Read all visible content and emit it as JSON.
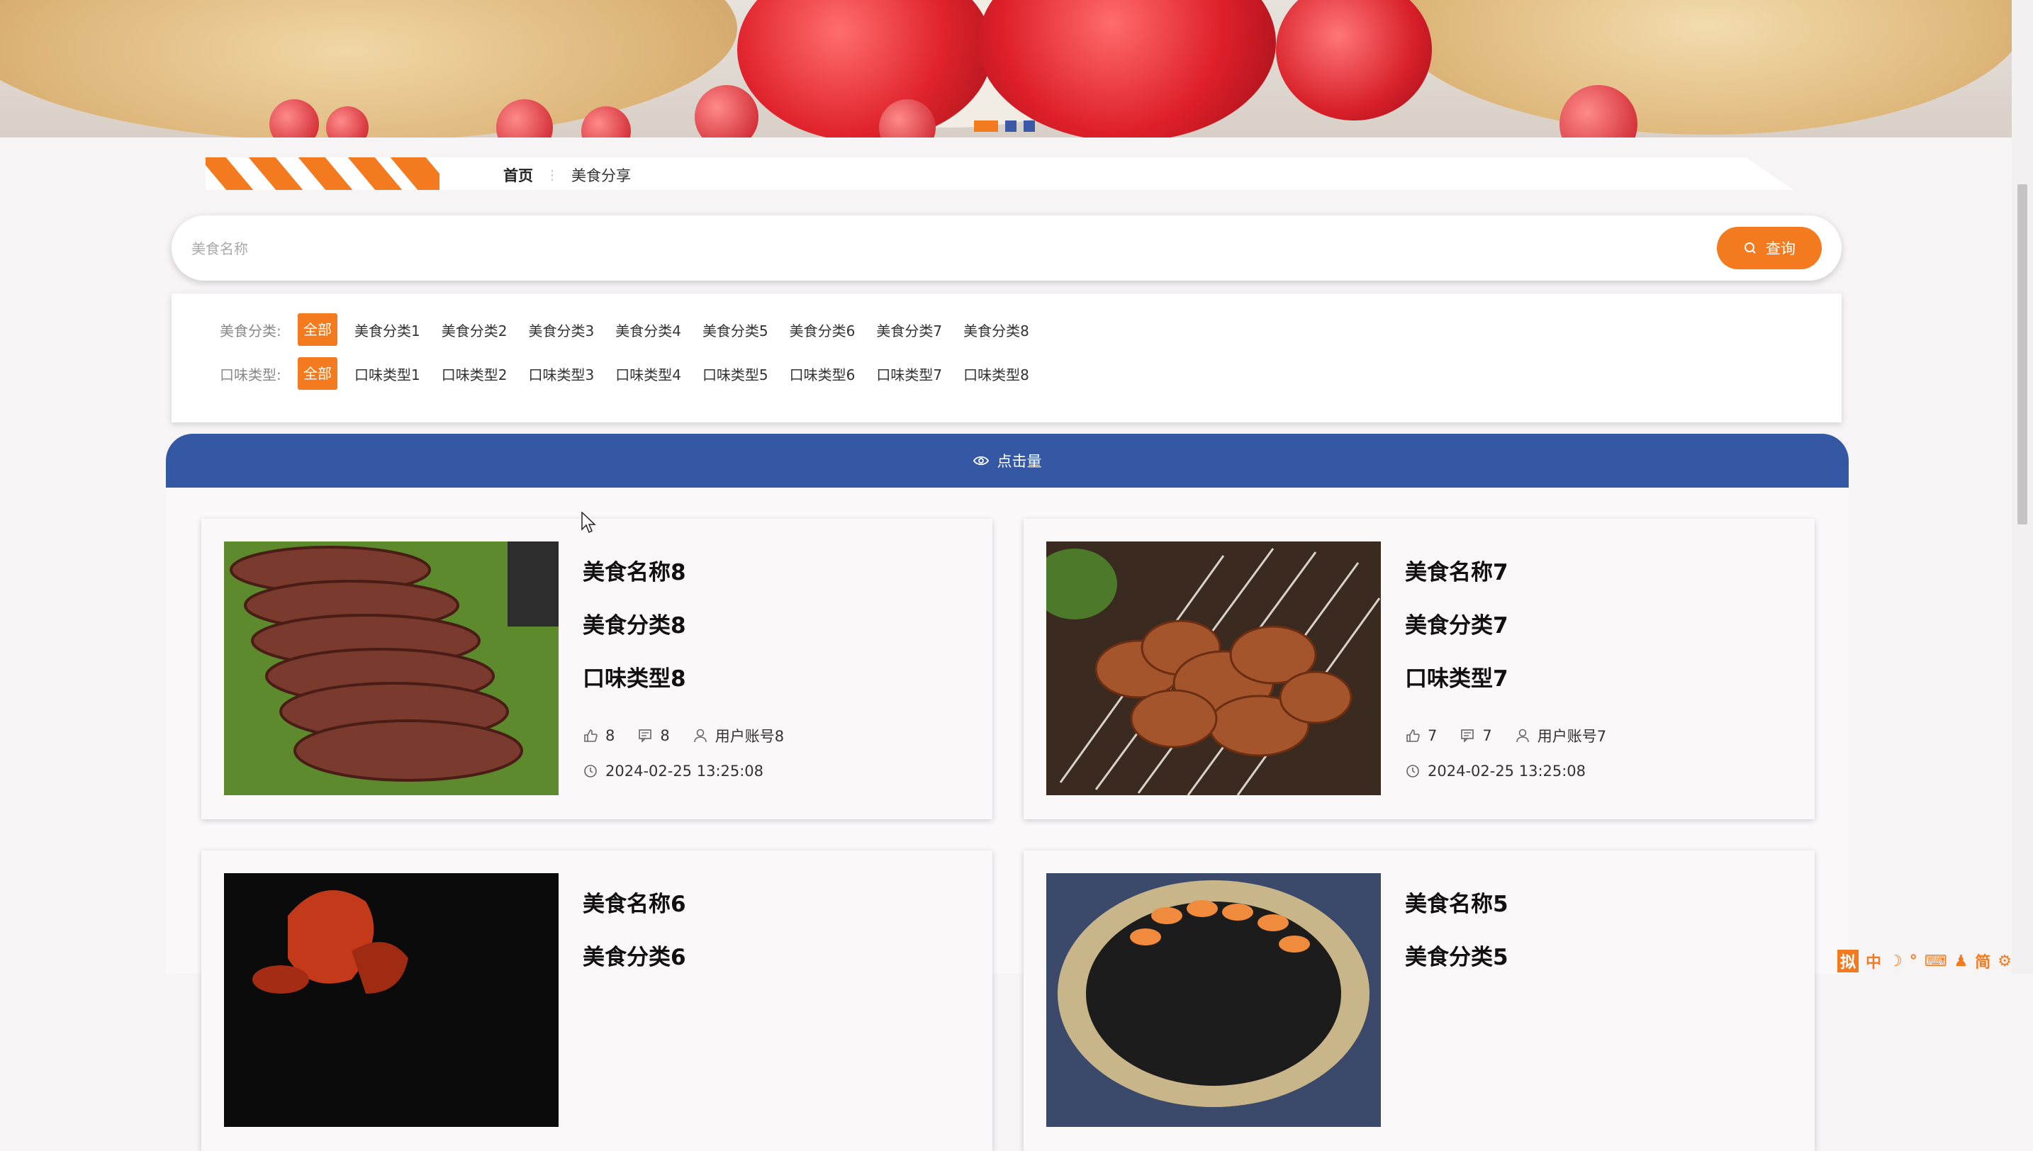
{
  "banner": {
    "active_slide": 1,
    "slide_count": 3
  },
  "breadcrumb": {
    "home": "首页",
    "separator": "⋮",
    "current": "美食分享"
  },
  "search": {
    "placeholder": "美食名称",
    "value": "",
    "button_label": "查询"
  },
  "filters": {
    "category": {
      "label": "美食分类:",
      "all_label": "全部",
      "options": [
        "美食分类1",
        "美食分类2",
        "美食分类3",
        "美食分类4",
        "美食分类5",
        "美食分类6",
        "美食分类7",
        "美食分类8"
      ]
    },
    "taste": {
      "label": "口味类型:",
      "all_label": "全部",
      "options": [
        "口味类型1",
        "口味类型2",
        "口味类型3",
        "口味类型4",
        "口味类型5",
        "口味类型6",
        "口味类型7",
        "口味类型8"
      ]
    }
  },
  "sort": {
    "label": "点击量"
  },
  "cards": [
    {
      "name": "美食名称8",
      "category": "美食分类8",
      "taste": "口味类型8",
      "likes": "8",
      "comments": "8",
      "user": "用户账号8",
      "time": "2024-02-25 13:25:08"
    },
    {
      "name": "美食名称7",
      "category": "美食分类7",
      "taste": "口味类型7",
      "likes": "7",
      "comments": "7",
      "user": "用户账号7",
      "time": "2024-02-25 13:25:08"
    },
    {
      "name": "美食名称6",
      "category": "美食分类6",
      "taste": "",
      "likes": "",
      "comments": "",
      "user": "",
      "time": ""
    },
    {
      "name": "美食名称5",
      "category": "美食分类5",
      "taste": "",
      "likes": "",
      "comments": "",
      "user": "",
      "time": ""
    }
  ],
  "tray": {
    "items": [
      "拟",
      "中",
      "☽",
      "°",
      "⌨",
      "♟",
      "简",
      "⚙"
    ]
  },
  "colors": {
    "accent": "#f47a1f",
    "sort_bar": "#3558a5",
    "background": "#f7f4f6"
  }
}
